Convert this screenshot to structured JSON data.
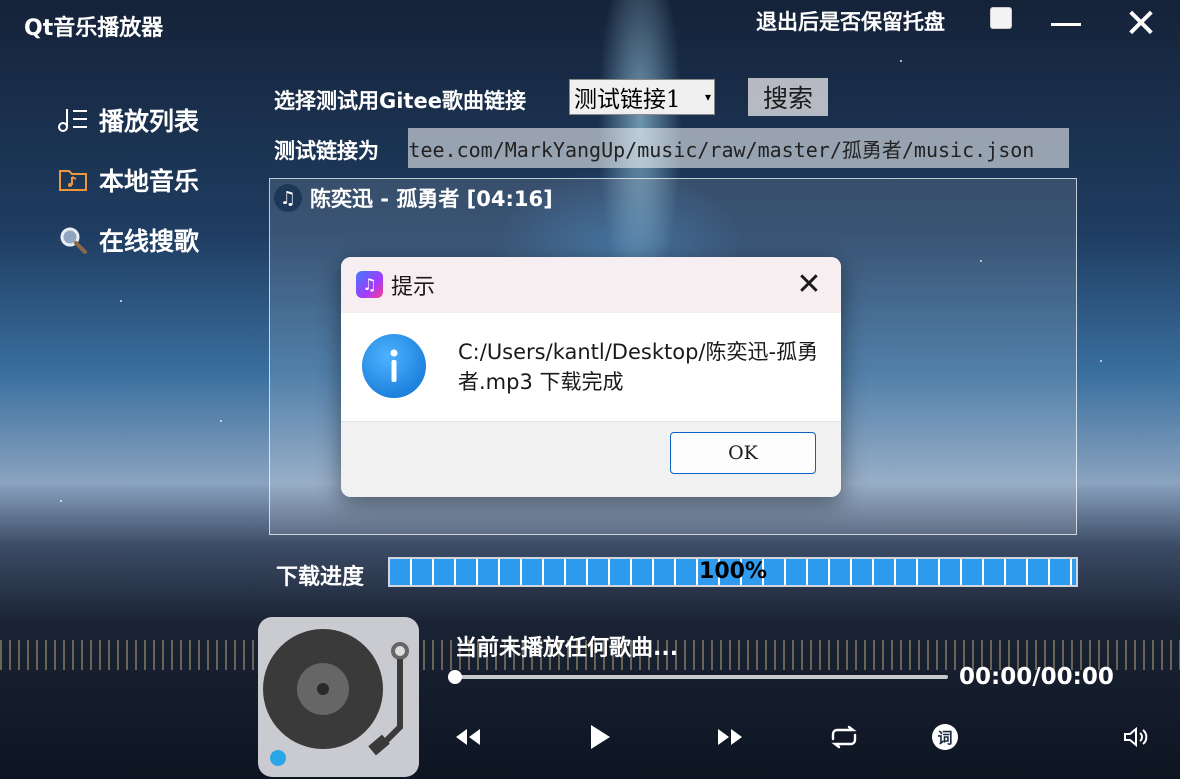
{
  "app": {
    "title": "Qt音乐播放器"
  },
  "tray": {
    "label": "退出后是否保留托盘",
    "checked": false
  },
  "sidebar": {
    "items": [
      {
        "label": "播放列表",
        "icon": "playlist-icon"
      },
      {
        "label": "本地音乐",
        "icon": "folder-music-icon"
      },
      {
        "label": "在线搜歌",
        "icon": "search-icon"
      }
    ]
  },
  "search": {
    "select_label": "选择测试用Gitee歌曲链接",
    "select_value": "测试链接1",
    "search_button": "搜索",
    "link_label": "测试链接为",
    "link_value": "https://gitee.com/MarkYangUp/music/raw/master/孤勇者/music.json"
  },
  "song_list": {
    "items": [
      {
        "text": "陈奕迅 - 孤勇者 [04:16]",
        "icon": "music-note-icon"
      }
    ]
  },
  "download": {
    "label": "下载进度",
    "progress": 100,
    "progress_text": "100%"
  },
  "player": {
    "now_playing": "当前未播放任何歌曲...",
    "time": "00:00/00:00",
    "controls": [
      "rewind-icon",
      "play-icon",
      "fast-forward-icon",
      "repeat-icon",
      "lyrics-icon",
      "volume-icon"
    ],
    "lyrics_glyph": "词"
  },
  "dialog": {
    "title": "提示",
    "message": "C:/Users/kantl/Desktop/陈奕迅-孤勇者.mp3 下载完成",
    "ok": "OK",
    "accent": "#0a63c2"
  }
}
